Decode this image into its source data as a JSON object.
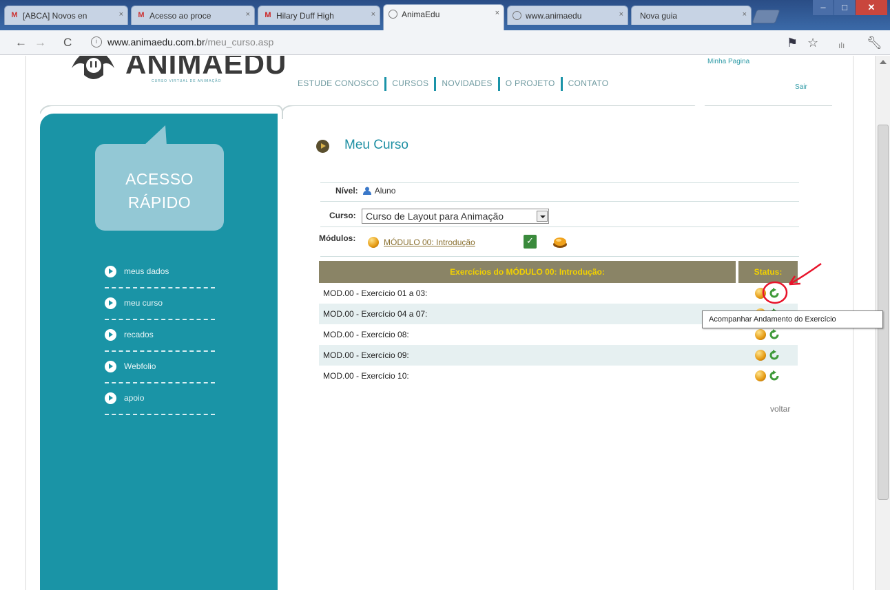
{
  "browser": {
    "tabs": [
      {
        "label": "[ABCA] Novos en",
        "icon": "gmail-icon"
      },
      {
        "label": "Acesso ao proce",
        "icon": "gmail-icon"
      },
      {
        "label": "Hilary Duff High",
        "icon": "m-icon"
      },
      {
        "label": "AnimaEdu",
        "icon": "page-icon",
        "active": true
      },
      {
        "label": "www.animaedu",
        "icon": "page-icon"
      },
      {
        "label": "Nova guia",
        "icon": "none"
      }
    ],
    "url_host": "www.animaedu.com.br",
    "url_path": "/meu_curso.asp"
  },
  "site": {
    "logo_text": "ANIMAEDU",
    "logo_tagline": "CURSO VIRTUAL DE ANIMAÇÃO",
    "nav": [
      "ESTUDE CONOSCO",
      "CURSOS",
      "NOVIDADES",
      "O PROJETO",
      "CONTATO"
    ],
    "minha_pagina": "Minha Pagina",
    "sair": "Sair"
  },
  "sidebar": {
    "quick_access_line1": "ACESSO",
    "quick_access_line2": "RÁPIDO",
    "items": [
      "meus dados",
      "meu curso",
      "recados",
      "Webfolio",
      "apoio"
    ]
  },
  "main": {
    "title": "Meu Curso",
    "nivel_label": "Nível:",
    "nivel_value": "Aluno",
    "curso_label": "Curso:",
    "curso_value": "Curso de Layout para Animação",
    "modulos_label": "Módulos:",
    "modulo_link": "MÓDULO 00: Introdução",
    "table_header": "Exercícios do MÓDULO 00: Introdução:",
    "status_header": "Status:",
    "rows": [
      "MOD.00 - Exercício 01 a 03:",
      "MOD.00 - Exercício 04 a 07:",
      "MOD.00 - Exercício 08:",
      "MOD.00 - Exercício 09:",
      "MOD.00 - Exercício 10:"
    ],
    "voltar": "voltar",
    "tooltip": "Acompanhar Andamento do Exercício"
  },
  "colors": {
    "sidebar": "#1a94a6",
    "accent": "#1e8fa3",
    "table_header_bg": "#8a8466",
    "table_header_text": "#f2d100",
    "annotation": "#e8132a"
  }
}
